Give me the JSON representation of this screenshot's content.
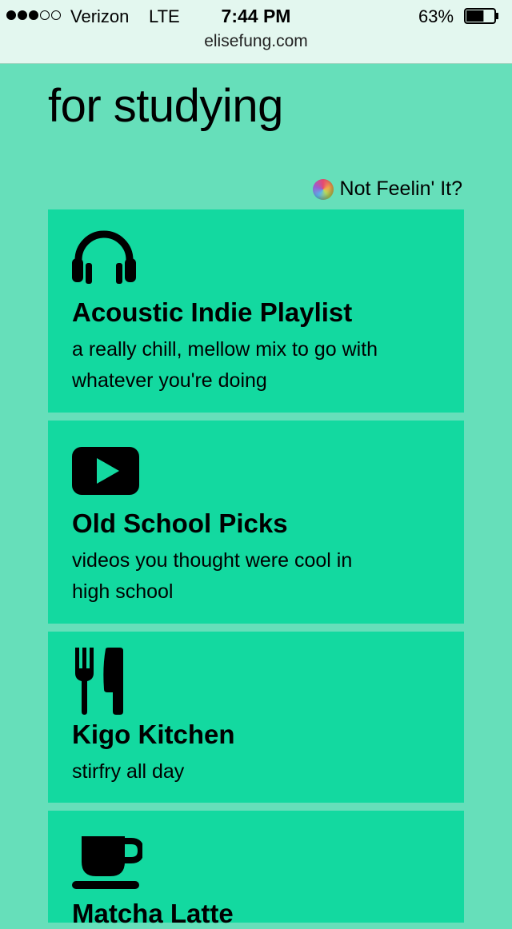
{
  "status_bar": {
    "carrier": "Verizon",
    "network": "LTE",
    "time": "7:44 PM",
    "battery": "63%",
    "battery_level": 0.63
  },
  "browser": {
    "url": "elisefung.com"
  },
  "page": {
    "title": "for studying",
    "shuffle_label": "Not Feelin' It?"
  },
  "cards": [
    {
      "icon": "headphones-icon",
      "title": "Acoustic Indie Playlist",
      "description": "a really chill, mellow mix to go with whatever you're doing"
    },
    {
      "icon": "play-icon",
      "title": "Old School Picks",
      "description": "videos you thought were cool in high school"
    },
    {
      "icon": "utensils-icon",
      "title": "Kigo Kitchen",
      "description": "stirfry all day"
    },
    {
      "icon": "coffee-cup-icon",
      "title": "Matcha Latte",
      "description": ""
    }
  ],
  "colors": {
    "page_background": "#66dfba",
    "card_background": "#13d9a0",
    "status_background": "#e3f7ef"
  }
}
